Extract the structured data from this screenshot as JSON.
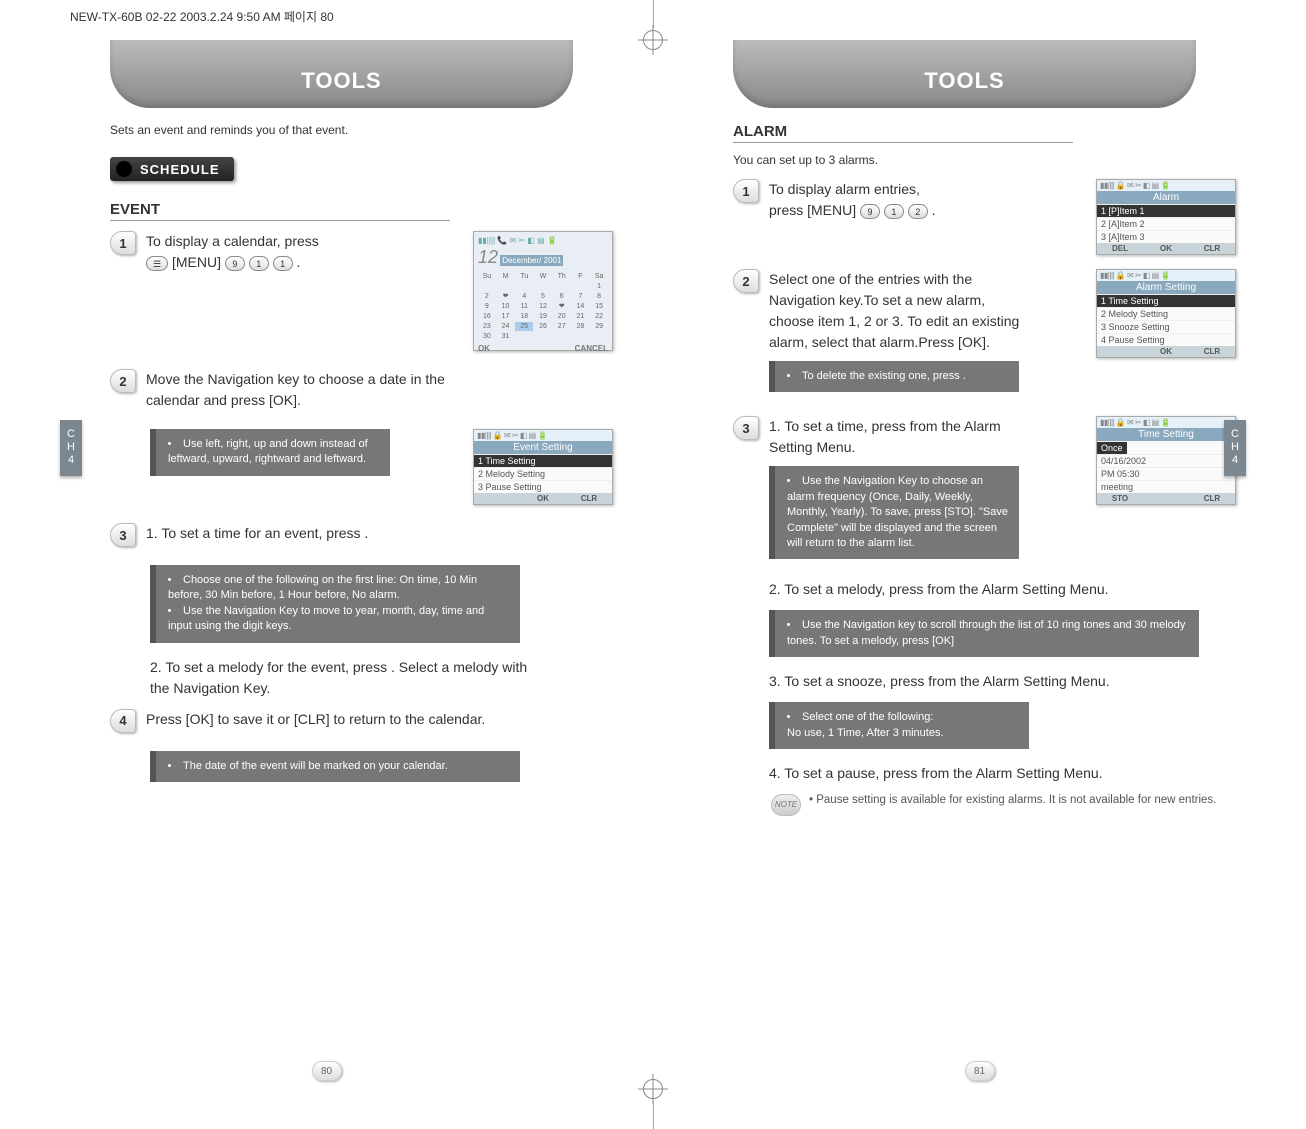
{
  "file_header": "NEW-TX-60B 02-22  2003.2.24 9:50 AM  페이지 80",
  "left": {
    "title": "TOOLS",
    "subtitle": "Sets an event and reminds you of that event.",
    "section": "SCHEDULE",
    "heading": "EVENT",
    "s1": {
      "num": "1",
      "text_a": "To display a calendar, press",
      "text_b": "[MENU]"
    },
    "cal": {
      "date": "12",
      "month": "December/ 2001",
      "ok": "OK",
      "cancel": "CANCEL"
    },
    "s2": {
      "num": "2",
      "text": "Move the Navigation key to choose a date in the calendar and  press        [OK]."
    },
    "tip1": "Use left, right, up and down instead of leftward, upward, rightward and leftward.",
    "scr_event": {
      "title": "Event Setting",
      "r1": "1 Time Setting",
      "r2": "2 Melody Setting",
      "r3": "3 Pause Setting",
      "ok": "OK",
      "clr": "CLR"
    },
    "s3": {
      "num": "3",
      "text": "1. To set a time for an event, press         ."
    },
    "tip2a": "Choose one of the following on the first line: On time, 10 Min before, 30 Min before, 1 Hour before, No alarm.",
    "tip2b": "Use the Navigation Key to move to year, month, day, time and input using the digit keys.",
    "sub2": "2. To set a melody for the event, press          . Select a melody with the Navigation Key.",
    "s4": {
      "num": "4",
      "text": "Press       [OK] to save it or         [CLR] to return to the calendar."
    },
    "tip3": "The date of the event will be marked on your calendar.",
    "page": "80",
    "ch": "CH4"
  },
  "right": {
    "title": "TOOLS",
    "heading": "ALARM",
    "subtitle": "You can set up to 3 alarms.",
    "s1": {
      "num": "1",
      "text_a": "To display alarm entries,",
      "text_b": "press         [MENU]"
    },
    "scr_alarm": {
      "title": "Alarm",
      "r1": "1 [P]Item 1",
      "r2": "2 [A]Item 2",
      "r3": "3 [A]Item 3",
      "del": "DEL",
      "ok": "OK",
      "clr": "CLR"
    },
    "s2": {
      "num": "2",
      "text": "Select one of the entries with the Navigation key.To set a new alarm, choose item 1, 2 or 3. To edit an existing alarm, select that alarm.Press        [OK]."
    },
    "tip1": "To delete the existing one, press        .",
    "scr_setting": {
      "title": "Alarm Setting",
      "r1": "1 Time Setting",
      "r2": "2 Melody Setting",
      "r3": "3 Snooze Setting",
      "r4": "4 Pause Setting",
      "ok": "OK",
      "clr": "CLR"
    },
    "s3": {
      "num": "3",
      "text": "1. To set a time, press          from the Alarm Setting Menu."
    },
    "tip2": "Use the Navigation Key to choose an alarm frequency (Once, Daily, Weekly, Monthly, Yearly). To save, press        [STO]. \"Save Complete\" will be displayed and the screen will return to the alarm list.",
    "scr_time": {
      "title": "Time Setting",
      "r1": "Once",
      "r2": "04/16/2002",
      "r3": "PM 05:30",
      "r4": "meeting",
      "sto": "STO",
      "clr": "CLR"
    },
    "sub2": "2. To set a melody, press          from the Alarm Setting Menu.",
    "tip3": "Use the Navigation key to scroll through the list of 10 ring tones and 30 melody tones. To set a melody, press       [OK]",
    "sub3": "3. To set a snooze, press          from the Alarm Setting Menu.",
    "tip4a": "Select one of the following:",
    "tip4b": "No use, 1 Time, After 3 minutes.",
    "sub4": "4. To set a pause, press           from the Alarm Setting Menu.",
    "note_label": "NOTE",
    "note": "Pause setting is available for existing alarms. It is not available for new entries.",
    "page": "81",
    "ch": "CH4"
  }
}
